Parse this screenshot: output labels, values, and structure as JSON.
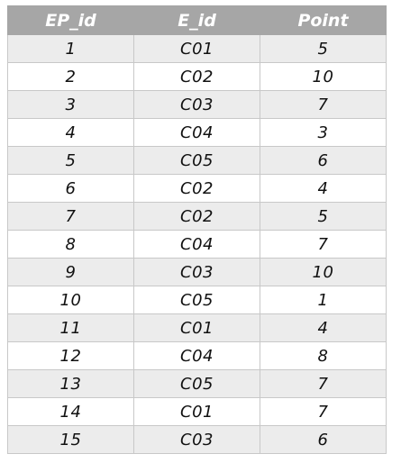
{
  "headers": {
    "ep_id": "EP_id",
    "e_id": "E_id",
    "point": "Point"
  },
  "rows": [
    {
      "ep_id": "1",
      "e_id": "C01",
      "point": "5"
    },
    {
      "ep_id": "2",
      "e_id": "C02",
      "point": "10"
    },
    {
      "ep_id": "3",
      "e_id": "C03",
      "point": "7"
    },
    {
      "ep_id": "4",
      "e_id": "C04",
      "point": "3"
    },
    {
      "ep_id": "5",
      "e_id": "C05",
      "point": "6"
    },
    {
      "ep_id": "6",
      "e_id": "C02",
      "point": "4"
    },
    {
      "ep_id": "7",
      "e_id": "C02",
      "point": "5"
    },
    {
      "ep_id": "8",
      "e_id": "C04",
      "point": "7"
    },
    {
      "ep_id": "9",
      "e_id": "C03",
      "point": "10"
    },
    {
      "ep_id": "10",
      "e_id": "C05",
      "point": "1"
    },
    {
      "ep_id": "11",
      "e_id": "C01",
      "point": "4"
    },
    {
      "ep_id": "12",
      "e_id": "C04",
      "point": "8"
    },
    {
      "ep_id": "13",
      "e_id": "C05",
      "point": "7"
    },
    {
      "ep_id": "14",
      "e_id": "C01",
      "point": "7"
    },
    {
      "ep_id": "15",
      "e_id": "C03",
      "point": "6"
    }
  ]
}
